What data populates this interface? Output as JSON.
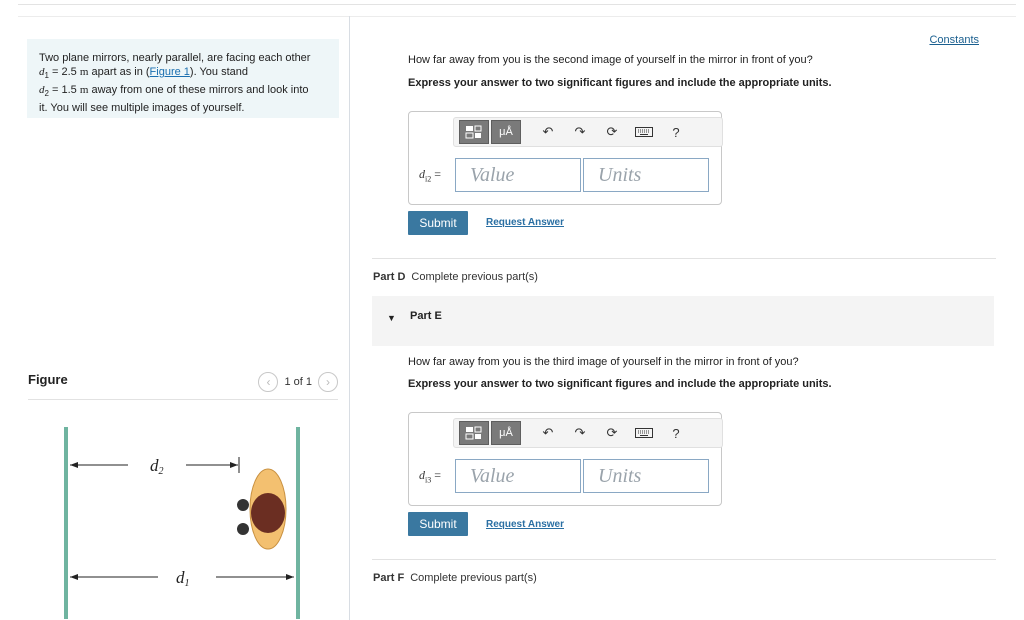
{
  "problem": {
    "intro": "Two plane mirrors, nearly parallel, are facing each other",
    "d1_var": "d",
    "d1_sub": "1",
    "d1_eq": " = 2.5 ",
    "d1_unit": "m",
    "d1_rest_pre": " apart as in (",
    "figure_link": "Figure 1",
    "d1_rest_post": "). You stand",
    "d2_var": "d",
    "d2_sub": "2",
    "d2_eq": " = 1.5 ",
    "d2_unit": "m",
    "d2_rest": " away from one of these mirrors and look into",
    "line4": "it. You will see multiple images of yourself."
  },
  "figure": {
    "title": "Figure",
    "pager_text": "1 of 1",
    "prev_icon": "chevron-left-icon",
    "next_icon": "chevron-right-icon",
    "label_d2": "d",
    "label_d2_sub": "2",
    "label_d1": "d",
    "label_d1_sub": "1",
    "mirror_color": "#6fb4a0",
    "person_shirt_color": "#f3c070",
    "person_hair_color": "#6b2e22"
  },
  "constants_link": "Constants",
  "part_c": {
    "question": "How far away from you is the second image of yourself in the mirror in front of you?",
    "instruction": "Express your answer to two significant figures and include the appropriate units.",
    "label": "d",
    "label_sub": "i2",
    "label_eq": " =",
    "value_placeholder": "Value",
    "units_placeholder": "Units",
    "submit": "Submit",
    "request_answer": "Request Answer"
  },
  "part_d": {
    "name": "Part D",
    "status": "Complete previous part(s)"
  },
  "part_e": {
    "name": "Part E",
    "question": "How far away from you is the third image of yourself in the mirror in front of you?",
    "instruction": "Express your answer to two significant figures and include the appropriate units.",
    "label": "d",
    "label_sub": "i3",
    "label_eq": " =",
    "value_placeholder": "Value",
    "units_placeholder": "Units",
    "submit": "Submit",
    "request_answer": "Request Answer"
  },
  "part_f": {
    "name": "Part F",
    "status": "Complete previous part(s)"
  },
  "toolbar": {
    "units_button_label": "μÅ",
    "help_label": "?",
    "icons": [
      "templates-icon",
      "units-icon",
      "undo-icon",
      "redo-icon",
      "reset-icon",
      "keyboard-icon",
      "help-icon"
    ]
  }
}
